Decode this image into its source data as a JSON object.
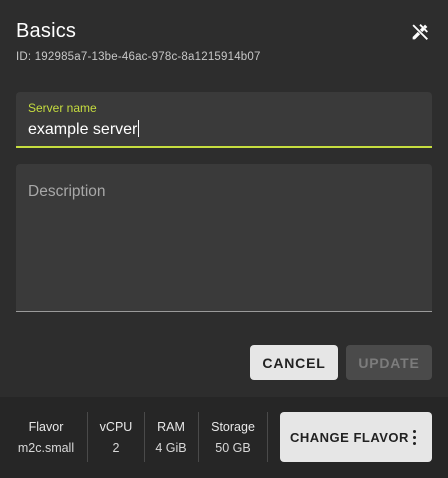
{
  "dialog": {
    "title": "Basics",
    "subtitle": "ID: 192985a7-13be-46ac-978c-8a1215914b07",
    "edit_icon": "edit-off-icon"
  },
  "form": {
    "name": {
      "label": "Server name",
      "value": "example server"
    },
    "description": {
      "label": "Description",
      "value": ""
    }
  },
  "actions": {
    "cancel_label": "CANCEL",
    "update_label": "UPDATE"
  },
  "specs": [
    {
      "label": "Flavor",
      "value": "m2c.small"
    },
    {
      "label": "vCPU",
      "value": "2"
    },
    {
      "label": "RAM",
      "value": "4 GiB"
    },
    {
      "label": "Storage",
      "value": "50 GB"
    }
  ],
  "change_flavor_label": "CHANGE FLAVOR",
  "colors": {
    "accent": "#c6dd3f",
    "surface": "#2d2d2d",
    "field": "#3a3a3a"
  }
}
